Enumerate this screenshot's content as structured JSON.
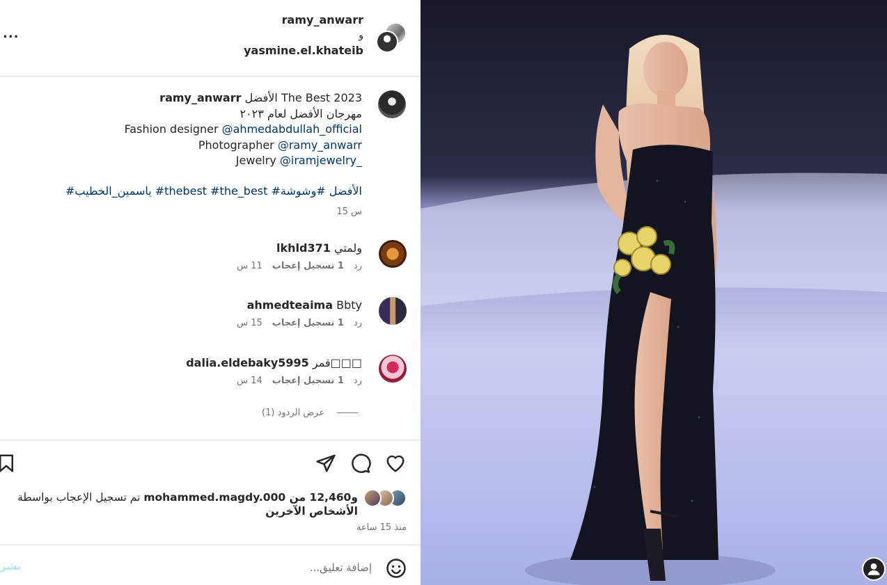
{
  "header": {
    "user1": "ramy_anwarr",
    "conjunction": "و",
    "user2": "yasmine.el.khateib",
    "more": "..."
  },
  "caption": {
    "username": "ramy_anwarr",
    "line1_text": " الأفضل The Best 2023",
    "line2": "مهرجان الأفضل لعام ٢٠٢٣",
    "line3_label": "Fashion designer ",
    "line3_mention": "@ahmedabdullah_official",
    "line4_label": "Photographer ",
    "line4_mention": "@ramy_anwarr",
    "line5_label": "Jewelry ",
    "line5_mention": "@iramjewelry_",
    "hashtags": "#ياسمين_الخطيب #thebest #the_best #الأفضل #وشوشة",
    "time": "15 س"
  },
  "comments": [
    {
      "username": "lkhld371",
      "text": "ولمتي",
      "time": "11 س",
      "likes": "1 تسجيل إعجاب",
      "reply": "رد"
    },
    {
      "username": "ahmedteaima",
      "text": "Bbty",
      "time": "15 س",
      "likes": "1 تسجيل إعجاب",
      "reply": "رد"
    },
    {
      "username": "dalia.eldebaky5995",
      "text": "قمر□□□",
      "time": "14 س",
      "likes": "1 تسجيل إعجاب",
      "reply": "رد"
    }
  ],
  "view_replies": "عرض الردود (1)",
  "likes": {
    "prefix": "تم تسجيل الإعجاب بواسطة ",
    "user": "mohammed.magdy.000",
    "suffix": " و12,460 من الأشخاص الآخرين"
  },
  "post_time": "منذ 15 ساعة",
  "comment_box": {
    "placeholder": "إضافة تعليق...",
    "post_label": "نشر"
  },
  "colors": {
    "link": "#00376b",
    "secondary_text": "#737373",
    "post_button": "#b2dffc",
    "divider": "#dbdbdb"
  }
}
